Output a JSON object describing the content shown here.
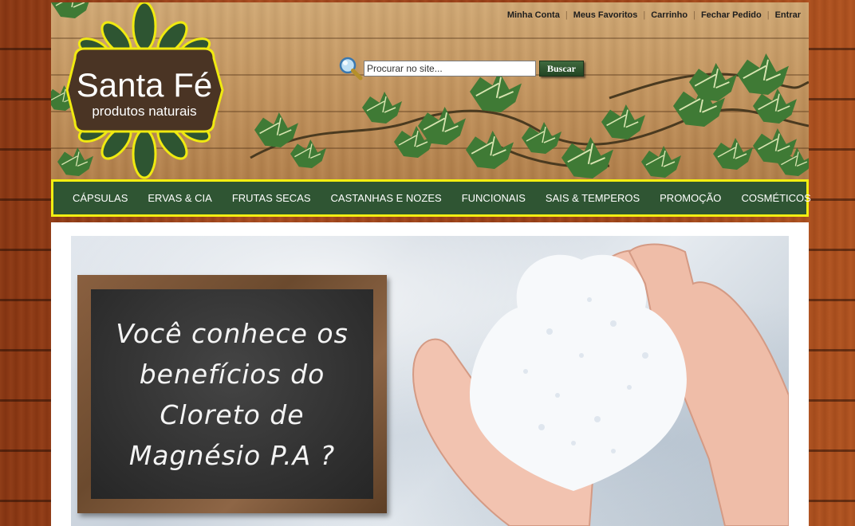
{
  "header": {
    "logo": {
      "title": "Santa Fé",
      "subtitle": "produtos naturais"
    },
    "top_links": [
      "Minha Conta",
      "Meus Favoritos",
      "Carrinho",
      "Fechar Pedido",
      "Entrar"
    ],
    "search": {
      "placeholder": "Procurar no site...",
      "button_label": "Buscar",
      "icon": "magnifier-icon"
    }
  },
  "nav": {
    "items": [
      "CÁPSULAS",
      "ERVAS & CIA",
      "FRUTAS SECAS",
      "CASTANHAS E NOZES",
      "FUNCIONAIS",
      "SAIS & TEMPEROS",
      "PROMOÇÃO",
      "COSMÉTICOS"
    ]
  },
  "banner": {
    "chalkboard_lines": [
      "Você conhece os",
      "benefícios do",
      "Cloreto de",
      "Magnésio P.A ?"
    ]
  },
  "colors": {
    "nav_background": "#2f5533",
    "nav_border": "#f2ee12",
    "logo_brown": "#4a3424",
    "logo_green": "#2e5532",
    "logo_border": "#f0ea10"
  }
}
